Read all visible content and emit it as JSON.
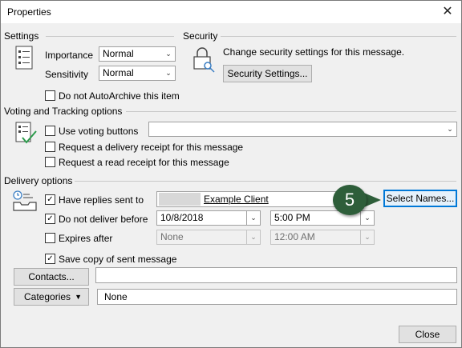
{
  "window": {
    "title": "Properties",
    "close_glyph": "✕"
  },
  "settings": {
    "heading": "Settings",
    "importance_label": "Importance",
    "importance_value": "Normal",
    "sensitivity_label": "Sensitivity",
    "sensitivity_value": "Normal",
    "autoarchive_label": "Do not AutoArchive this item",
    "autoarchive_checked": false,
    "icon": "document-properties-icon"
  },
  "security": {
    "heading": "Security",
    "description": "Change security settings for this message.",
    "button_label": "Security Settings...",
    "icon": "lock-key-icon"
  },
  "voting": {
    "heading": "Voting and Tracking options",
    "use_voting_label": "Use voting buttons",
    "use_voting_checked": false,
    "voting_value": "",
    "delivery_receipt_label": "Request a delivery receipt for this message",
    "delivery_receipt_checked": false,
    "read_receipt_label": "Request a read receipt for this message",
    "read_receipt_checked": false,
    "icon": "checklist-icon"
  },
  "delivery": {
    "heading": "Delivery options",
    "replies_label": "Have replies sent to",
    "replies_checked": true,
    "replies_value": "Example Client",
    "select_names_label": "Select Names...",
    "do_not_deliver_label": "Do not deliver before",
    "do_not_deliver_checked": true,
    "deliver_date": "10/8/2018",
    "deliver_time": "5:00 PM",
    "expires_label": "Expires after",
    "expires_checked": false,
    "expires_date": "None",
    "expires_time": "12:00 AM",
    "save_copy_label": "Save copy of sent message",
    "save_copy_checked": true,
    "icon": "outbox-tray-icon"
  },
  "contacts": {
    "button_label": "Contacts...",
    "value": ""
  },
  "categories": {
    "button_label": "Categories",
    "value": "None"
  },
  "footer": {
    "close_label": "Close"
  },
  "callout": {
    "step_number": "5",
    "color": "#2e5e3a"
  },
  "colors": {
    "focus_border": "#0078d7",
    "dialog_bg": "#f0f0f0"
  }
}
